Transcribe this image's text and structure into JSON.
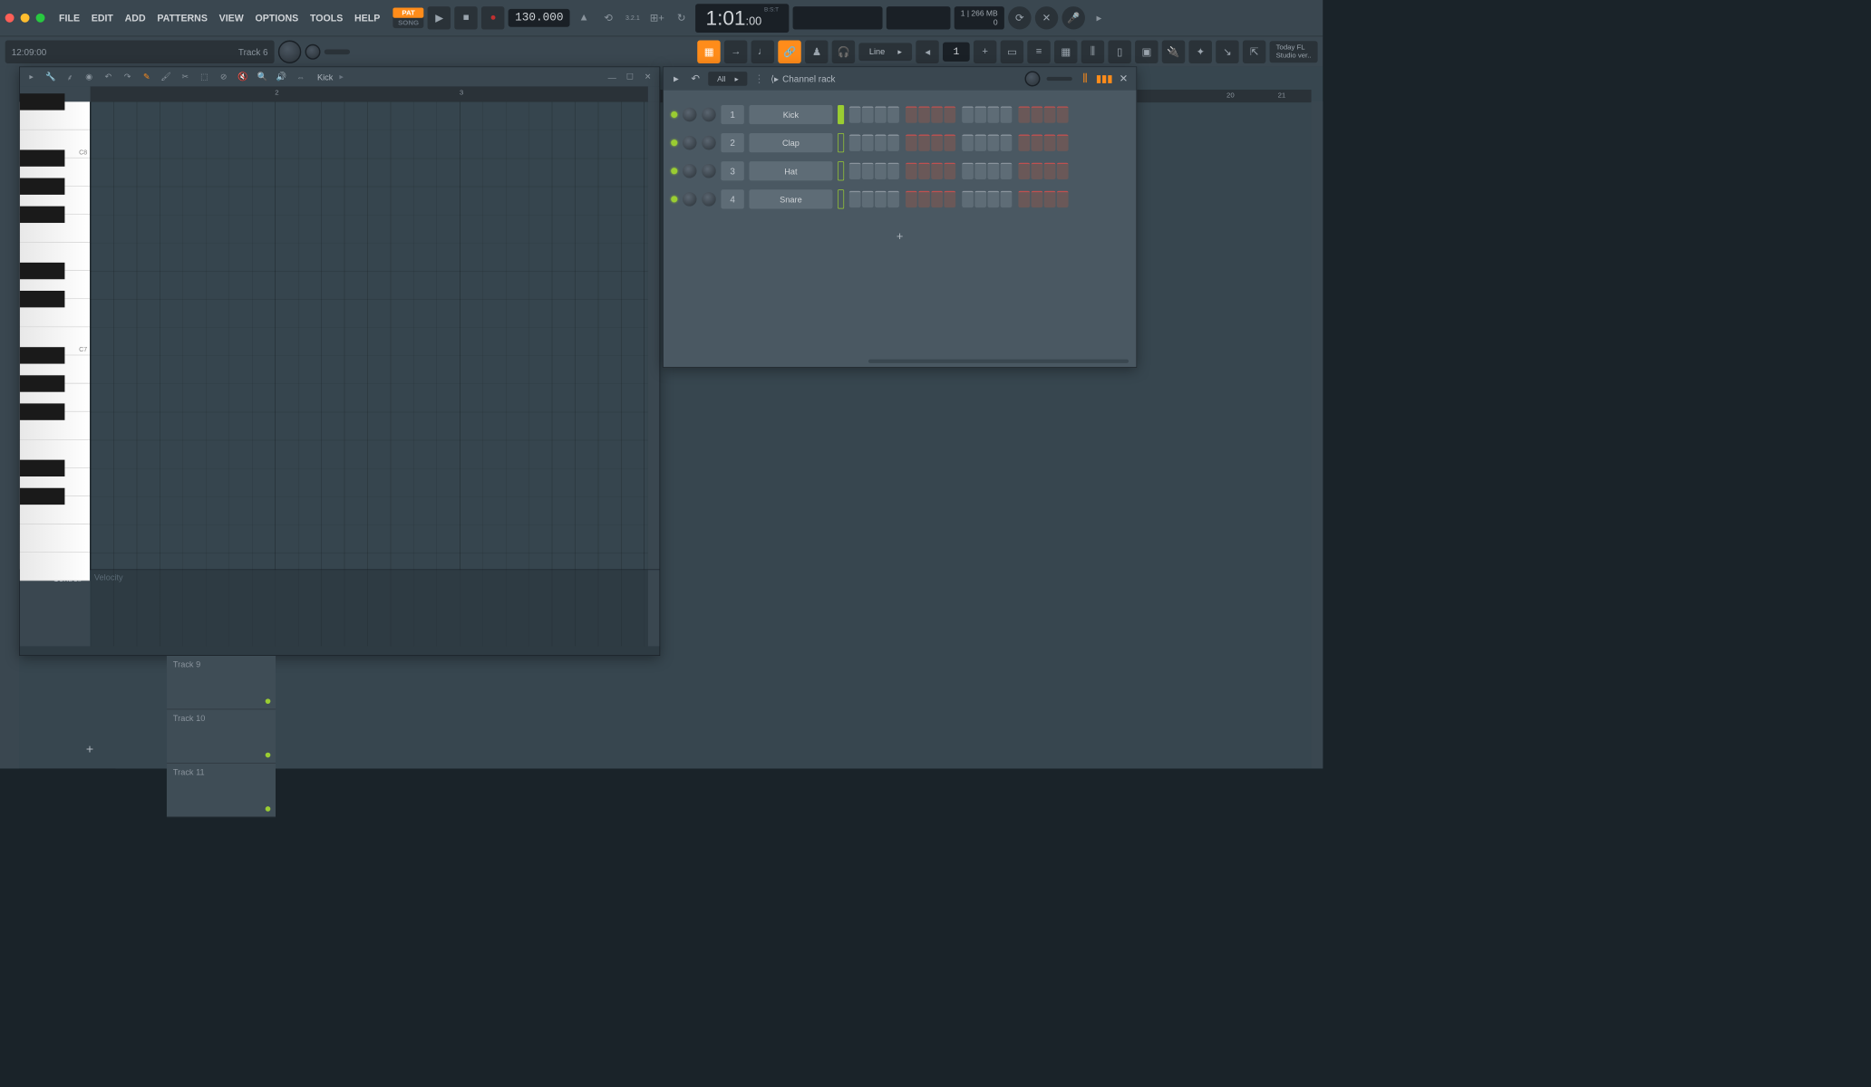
{
  "menu": [
    "FILE",
    "EDIT",
    "ADD",
    "PATTERNS",
    "VIEW",
    "OPTIONS",
    "TOOLS",
    "HELP"
  ],
  "transport": {
    "pat": "PAT",
    "song": "SONG",
    "tempo": "130.000"
  },
  "time_display": {
    "bars": "1",
    "beats": "01",
    "ticks": "00",
    "label": "B:S:T"
  },
  "cpu": {
    "line1": "1",
    "mem": "266 MB",
    "line2": "0"
  },
  "hint": {
    "time": "12:09:00",
    "context": "Track 6"
  },
  "snap": "Line",
  "pattern_num": "1",
  "news": {
    "line1": "Today FL",
    "line2": "Studio ver.."
  },
  "piano_roll": {
    "title": "Kick",
    "ruler": [
      "2",
      "3"
    ],
    "key_labels": [
      "C8",
      "C7"
    ],
    "control_label": "Control",
    "velocity": "Velocity"
  },
  "channel_rack": {
    "filter": "All",
    "title": "Channel rack",
    "channels": [
      {
        "num": "1",
        "name": "Kick",
        "selected": true
      },
      {
        "num": "2",
        "name": "Clap",
        "selected": false
      },
      {
        "num": "3",
        "name": "Hat",
        "selected": false
      },
      {
        "num": "4",
        "name": "Snare",
        "selected": false
      }
    ]
  },
  "playlist": {
    "ruler": [
      "20",
      "21"
    ],
    "tracks": [
      "Track 9",
      "Track 10",
      "Track 11"
    ]
  }
}
